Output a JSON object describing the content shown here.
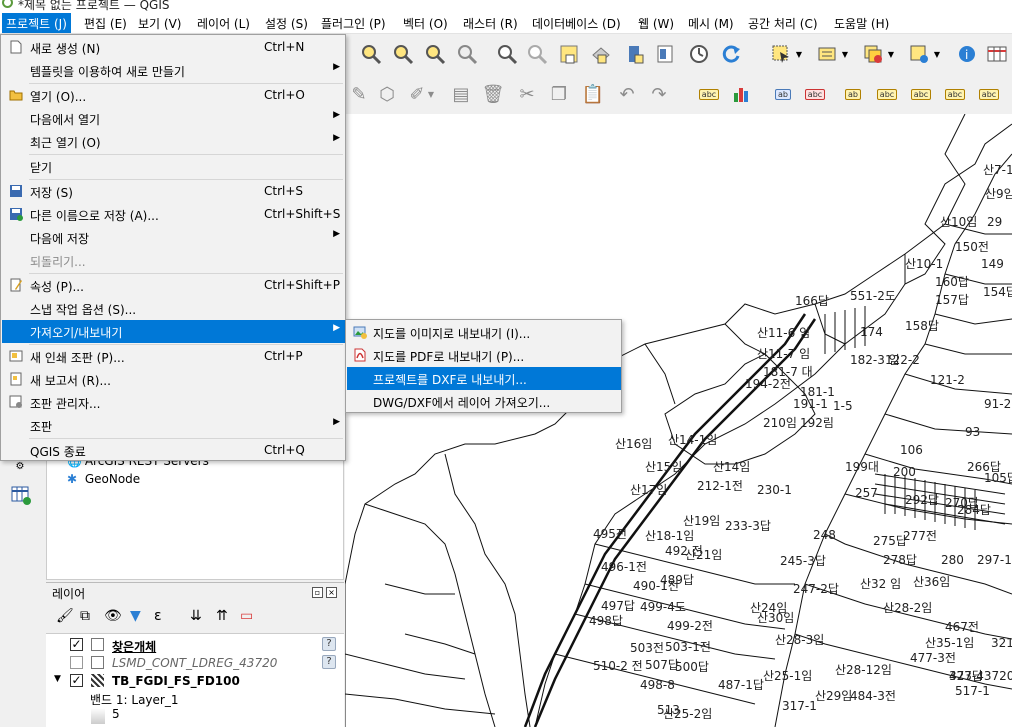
{
  "window": {
    "title": "*제목 없는 프로젝트 — QGIS"
  },
  "menubar": [
    {
      "label": "프로젝트 (J)",
      "active": true
    },
    {
      "label": "편집 (E)"
    },
    {
      "label": "보기 (V)"
    },
    {
      "label": "레이어 (L)"
    },
    {
      "label": "설정 (S)"
    },
    {
      "label": "플러그인 (P)"
    },
    {
      "label": "벡터 (O)"
    },
    {
      "label": "래스터 (R)"
    },
    {
      "label": "데이터베이스 (D)"
    },
    {
      "label": "웹 (W)"
    },
    {
      "label": "메시 (M)"
    },
    {
      "label": "공간 처리 (C)"
    },
    {
      "label": "도움말 (H)"
    }
  ],
  "project_menu": {
    "items": [
      {
        "label": "새로 생성 (N)",
        "shortcut": "Ctrl+N",
        "icon": "new-project-icon"
      },
      {
        "label": "템플릿을 이용하여 새로 만들기",
        "submenu": true
      },
      {
        "label": "열기 (O)...",
        "shortcut": "Ctrl+O",
        "icon": "open-folder-icon"
      },
      {
        "label": "다음에서 열기",
        "submenu": true
      },
      {
        "label": "최근 열기 (O)",
        "submenu": true
      },
      {
        "label": "닫기"
      },
      {
        "label": "저장 (S)",
        "shortcut": "Ctrl+S",
        "icon": "save-icon"
      },
      {
        "label": "다른 이름으로 저장 (A)...",
        "shortcut": "Ctrl+Shift+S",
        "icon": "save-as-icon"
      },
      {
        "label": "다음에 저장",
        "submenu": true
      },
      {
        "label": "되돌리기...",
        "disabled": true
      },
      {
        "label": "속성 (P)...",
        "shortcut": "Ctrl+Shift+P",
        "icon": "properties-icon"
      },
      {
        "label": "스냅 작업 옵션 (S)..."
      },
      {
        "label": "가져오기/내보내기",
        "submenu": true,
        "selected": true
      },
      {
        "label": "새 인쇄 조판 (P)...",
        "shortcut": "Ctrl+P",
        "icon": "new-layout-icon"
      },
      {
        "label": "새 보고서 (R)...",
        "icon": "new-report-icon"
      },
      {
        "label": "조판 관리자...",
        "icon": "layout-manager-icon"
      },
      {
        "label": "조판",
        "submenu": true
      },
      {
        "label": "QGIS 종료",
        "shortcut": "Ctrl+Q"
      }
    ]
  },
  "import_export_submenu": {
    "items": [
      {
        "label": "지도를 이미지로 내보내기 (I)...",
        "icon": "export-image-icon"
      },
      {
        "label": "지도를 PDF로 내보내기 (P)...",
        "icon": "pdf-icon"
      },
      {
        "label": "프로젝트를 DXF로 내보내기...",
        "selected": true
      },
      {
        "label": "DWG/DXF에서 레이어 가져오기..."
      }
    ]
  },
  "browser": {
    "items": [
      {
        "label": "ArcGIS REST Servers",
        "icon": "globe-icon"
      },
      {
        "label": "GeoNode",
        "icon": "geonode-icon"
      }
    ]
  },
  "layers_panel": {
    "title": "레이어",
    "layers": [
      {
        "name": "찾은개체",
        "checked": true,
        "bold": true
      },
      {
        "name": "LSMD_CONT_LDREG_43720",
        "checked": false,
        "italic": true
      },
      {
        "name": "TB_FGDI_FS_FD100",
        "checked": true,
        "bold": true
      }
    ],
    "band_label": "밴드 1: Layer_1",
    "band_value": "5"
  },
  "map_labels": [
    "산7-1",
    "산9임",
    "산10임",
    "29",
    "150전",
    "산10-1",
    "149",
    "160답",
    "154답",
    "551-2도",
    "166답",
    "157답",
    "산11-6 임",
    "158답",
    "174",
    "산11-7 임",
    "182-3 임",
    "122-2",
    "181-7 대",
    "121-2",
    "194-2전",
    "181-1",
    "191-1",
    "1-5",
    "210임",
    "192림",
    "91-2",
    "산16임",
    "산14-1임",
    "93",
    "산15임",
    "산14임",
    "199대",
    "106",
    "200",
    "266답",
    "105답",
    "212-1전",
    "산17임",
    "257",
    "292답",
    "270답",
    "284답",
    "230-1",
    "산19임",
    "233-3답",
    "495전",
    "산18-1임",
    "492 전",
    "248",
    "275답",
    "277전",
    "496-1전",
    "산21임",
    "245-3답",
    "278답",
    "280",
    "297-1",
    "490-1전",
    "489답",
    "247-2답",
    "산32 임",
    "산36임",
    "497답",
    "499-4도",
    "산24임",
    "산28-2임",
    "498답",
    "산30임",
    "467전",
    "499-2전",
    "503전",
    "503-1전",
    "산28-3임",
    "산35-1임",
    "321",
    "500답",
    "477-3전",
    "510-2 전",
    "507답",
    "산25-1임",
    "산28-12임",
    "477-43720",
    "323답",
    "498-8",
    "487-1답",
    "산29임",
    "484-3전",
    "517-1",
    "513",
    "산25-2임",
    "317-1"
  ]
}
